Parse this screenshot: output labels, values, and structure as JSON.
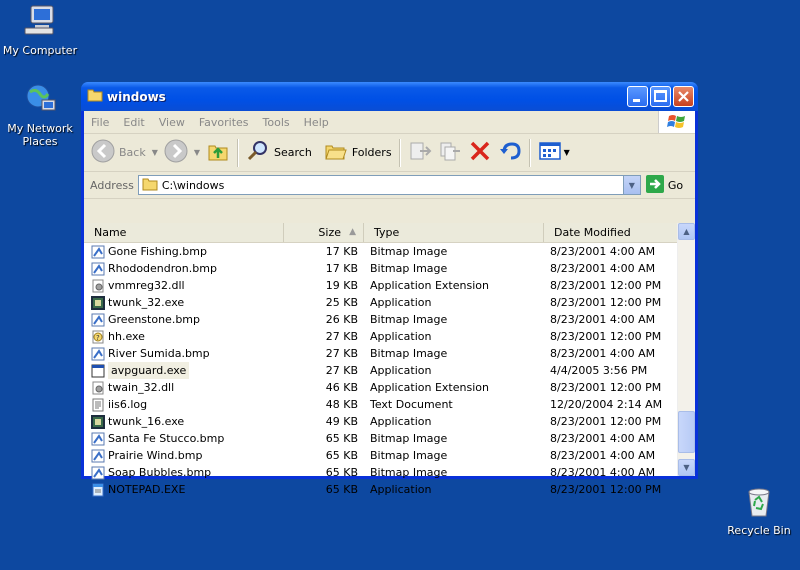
{
  "desktop": {
    "icons": [
      {
        "label": "My Computer",
        "icon": "my-computer-icon"
      },
      {
        "label": "My Network Places",
        "icon": "network-places-icon"
      },
      {
        "label": "Recycle Bin",
        "icon": "recycle-bin-icon"
      }
    ]
  },
  "window": {
    "title": "windows",
    "menu": [
      "File",
      "Edit",
      "View",
      "Favorites",
      "Tools",
      "Help"
    ],
    "toolbar": {
      "back": "Back",
      "search": "Search",
      "folders": "Folders"
    },
    "address": {
      "label": "Address",
      "value": "C:\\windows",
      "go": "Go"
    },
    "columns": [
      "Name",
      "Size",
      "Type",
      "Date Modified"
    ],
    "files": [
      {
        "name": "Gone Fishing.bmp",
        "size": "17 KB",
        "type": "Bitmap Image",
        "date": "8/23/2001 4:00 AM",
        "icon": "bitmap-icon"
      },
      {
        "name": "Rhododendron.bmp",
        "size": "17 KB",
        "type": "Bitmap Image",
        "date": "8/23/2001 4:00 AM",
        "icon": "bitmap-icon"
      },
      {
        "name": "vmmreg32.dll",
        "size": "19 KB",
        "type": "Application Extension",
        "date": "8/23/2001 12:00 PM",
        "icon": "dll-icon"
      },
      {
        "name": "twunk_32.exe",
        "size": "25 KB",
        "type": "Application",
        "date": "8/23/2001 12:00 PM",
        "icon": "twain-exe-icon"
      },
      {
        "name": "Greenstone.bmp",
        "size": "26 KB",
        "type": "Bitmap Image",
        "date": "8/23/2001 4:00 AM",
        "icon": "bitmap-icon"
      },
      {
        "name": "hh.exe",
        "size": "27 KB",
        "type": "Application",
        "date": "8/23/2001 12:00 PM",
        "icon": "help-exe-icon"
      },
      {
        "name": "River Sumida.bmp",
        "size": "27 KB",
        "type": "Bitmap Image",
        "date": "8/23/2001 4:00 AM",
        "icon": "bitmap-icon"
      },
      {
        "name": "avpguard.exe",
        "size": "27 KB",
        "type": "Application",
        "date": "4/4/2005 3:56 PM",
        "icon": "app-window-icon",
        "selected": true
      },
      {
        "name": "twain_32.dll",
        "size": "46 KB",
        "type": "Application Extension",
        "date": "8/23/2001 12:00 PM",
        "icon": "dll-icon"
      },
      {
        "name": "iis6.log",
        "size": "48 KB",
        "type": "Text Document",
        "date": "12/20/2004 2:14 AM",
        "icon": "text-doc-icon"
      },
      {
        "name": "twunk_16.exe",
        "size": "49 KB",
        "type": "Application",
        "date": "8/23/2001 12:00 PM",
        "icon": "twain-exe-icon"
      },
      {
        "name": "Santa Fe Stucco.bmp",
        "size": "65 KB",
        "type": "Bitmap Image",
        "date": "8/23/2001 4:00 AM",
        "icon": "bitmap-icon"
      },
      {
        "name": "Prairie Wind.bmp",
        "size": "65 KB",
        "type": "Bitmap Image",
        "date": "8/23/2001 4:00 AM",
        "icon": "bitmap-icon"
      },
      {
        "name": "Soap Bubbles.bmp",
        "size": "65 KB",
        "type": "Bitmap Image",
        "date": "8/23/2001 4:00 AM",
        "icon": "bitmap-icon"
      },
      {
        "name": "NOTEPAD.EXE",
        "size": "65 KB",
        "type": "Application",
        "date": "8/23/2001 12:00 PM",
        "icon": "notepad-icon"
      }
    ]
  },
  "colors": {
    "desktop": "#0d48a0",
    "titlebar": "#0050e6",
    "window_bg": "#ece9d8"
  }
}
